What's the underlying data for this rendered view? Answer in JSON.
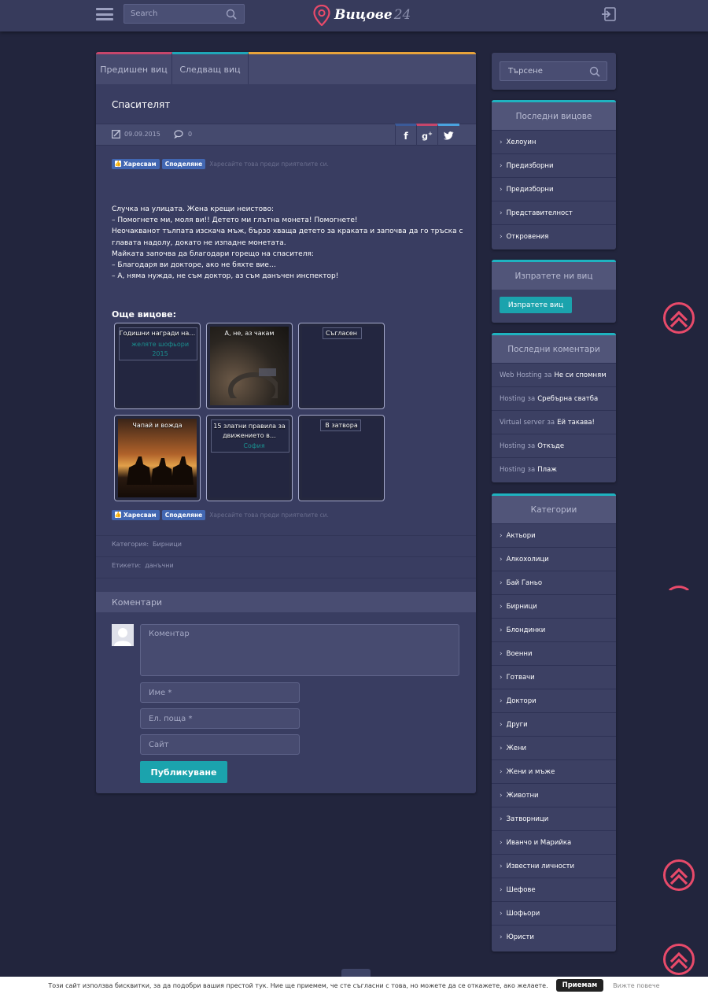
{
  "header": {
    "search_placeholder": "Search",
    "logo_text": "Вицове",
    "logo_number": "24"
  },
  "article": {
    "prev_label": "Предишен виц",
    "next_label": "Следващ виц",
    "title": "Спасителят",
    "date": "09.09.2015",
    "comment_count": "0",
    "like_label": "Харесвам",
    "share_label": "Споделяне",
    "fb_text": "Харесайте това преди приятелите си.",
    "joke_lines": [
      "Случка на улицата. Жена крещи неистово:",
      "– Помогнете ми, моля ви!! Детето ми глътна монета! Помогнете!",
      "Неочакванот тълпата изскача мъж, бързо хваща детето за краката и започва да го тръска с главата надолу, докато не изпадне монетата.",
      "Майката започва да благодари горещо на спасителя:",
      "– Благодаря ви докторе, ако не бяхте вие…",
      "– А, няма нужда,  не съм доктор, аз съм данъчен инспектор!"
    ],
    "more_title": "Още вицове:",
    "related": [
      {
        "title": "Годишни награди на…",
        "sub": "желяте шофьори 2015"
      },
      {
        "title": "А, не, аз чакам",
        "sub": ""
      },
      {
        "title": "Съгласен",
        "sub": ""
      },
      {
        "title": "Чапай и вожда",
        "sub": ""
      },
      {
        "title": "15 златни правила за движението в…",
        "sub": "София"
      },
      {
        "title": "В затвора",
        "sub": ""
      }
    ],
    "category_label": "Категория:",
    "category_value": "Бирници",
    "tags_label": "Етикети:",
    "tags_value": "данъчни"
  },
  "comments": {
    "heading": "Коментари",
    "comment_placeholder": "Коментар",
    "name_placeholder": "Име *",
    "email_placeholder": "Ел. поща *",
    "site_placeholder": "Сайт",
    "publish_label": "Публикуване"
  },
  "sidebar": {
    "search_placeholder": "Търсене",
    "latest_title": "Последни вицове",
    "latest": [
      "Хелоуин",
      "Предизборни",
      "Предизборни",
      "Представителност",
      "Откровения"
    ],
    "send_title": "Изпратете ни виц",
    "send_button": "Изпратете виц",
    "recent_comments_title": "Последни коментари",
    "recent_comments": [
      {
        "author": "Web Hosting",
        "joiner": "за",
        "post": "Не си спомням"
      },
      {
        "author": "Hosting",
        "joiner": "за",
        "post": "Сребърна сватба"
      },
      {
        "author": "Virtual server",
        "joiner": "за",
        "post": "Ей такава!"
      },
      {
        "author": "Hosting",
        "joiner": "за",
        "post": "Откъде"
      },
      {
        "author": "Hosting",
        "joiner": "за",
        "post": "Плаж"
      }
    ],
    "categories_title": "Категории",
    "categories": [
      "Актьори",
      "Алкохолици",
      "Бай Ганьо",
      "Бирници",
      "Блондинки",
      "Военни",
      "Готвачи",
      "Доктори",
      "Други",
      "Жени",
      "Жени и мъже",
      "Животни",
      "Затворници",
      "Иванчо и Марийка",
      "Известни личности",
      "Шефове",
      "Шофьори",
      "Юристи"
    ]
  },
  "cookie": {
    "text": "Този сайт използва бисквитки, за да подобри вашия престой тук. Ние ще приемем, че сте съгласни с това, но можете да се откажете, ако желаете.",
    "accept": "Приемам",
    "more": "Вижте повече"
  },
  "colors": {
    "background": "#22253d",
    "panel": "#393d61",
    "accent_teal": "#1ba3ad",
    "accent_pink": "#c6466b",
    "accent_orange": "#e7a33a",
    "scroll_top": "#e84a6a"
  }
}
